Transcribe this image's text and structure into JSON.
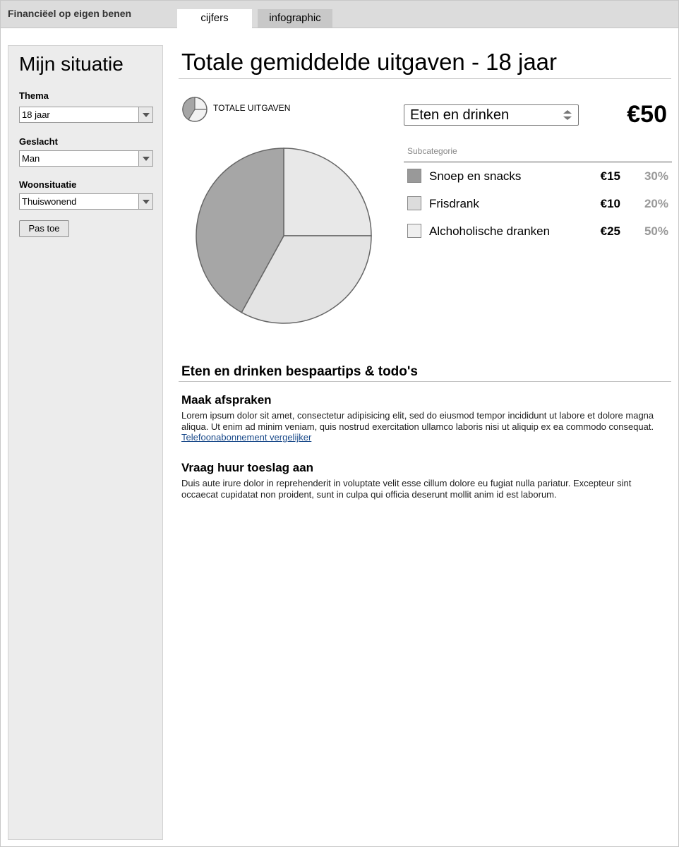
{
  "header": {
    "app_title": "Financiëel op eigen benen",
    "tabs": [
      {
        "label": "cijfers",
        "active": true
      },
      {
        "label": "infographic",
        "active": false
      }
    ]
  },
  "sidebar": {
    "title": "Mijn situatie",
    "fields": [
      {
        "label": "Thema",
        "value": "18 jaar"
      },
      {
        "label": "Geslacht",
        "value": "Man"
      },
      {
        "label": "Woonsituatie",
        "value": "Thuiswonend"
      }
    ],
    "apply_label": "Pas toe"
  },
  "main": {
    "title": "Totale gemiddelde uitgaven - 18 jaar",
    "mini_chart_label": "TOTALE UITGAVEN",
    "category_select": "Eten en drinken",
    "total": "€50",
    "subcategory_header": "Subcategorie",
    "subcategories": [
      {
        "name": "Snoep en snacks",
        "amount": "€15",
        "percent": "30%",
        "color": "#999999"
      },
      {
        "name": "Frisdrank",
        "amount": "€10",
        "percent": "20%",
        "color": "#dcdcdc"
      },
      {
        "name": "Alchoholische dranken",
        "amount": "€25",
        "percent": "50%",
        "color": "#efefef"
      }
    ]
  },
  "chart_data": {
    "type": "pie",
    "values": [
      25,
      33,
      42
    ],
    "colors": [
      "#e8e8e8",
      "#e4e4e4",
      "#a6a6a6"
    ],
    "title": "",
    "legend": "none"
  },
  "tips": {
    "title": "Eten en drinken bespaartips & todo's",
    "items": [
      {
        "heading": "Maak afspraken",
        "text": "Lorem ipsum dolor sit amet, consectetur adipisicing elit, sed do eiusmod tempor incididunt ut labore et dolore magna aliqua. Ut enim ad minim veniam, quis nostrud exercitation ullamco laboris nisi ut aliquip ex ea commodo consequat.",
        "link": "Telefoonabonnement vergelijker"
      },
      {
        "heading": "Vraag huur toeslag aan",
        "text": "Duis aute irure dolor in reprehenderit in voluptate velit esse cillum dolore eu fugiat nulla pariatur. Excepteur sint occaecat cupidatat non proident, sunt in culpa qui officia deserunt mollit anim id est laborum."
      }
    ]
  }
}
